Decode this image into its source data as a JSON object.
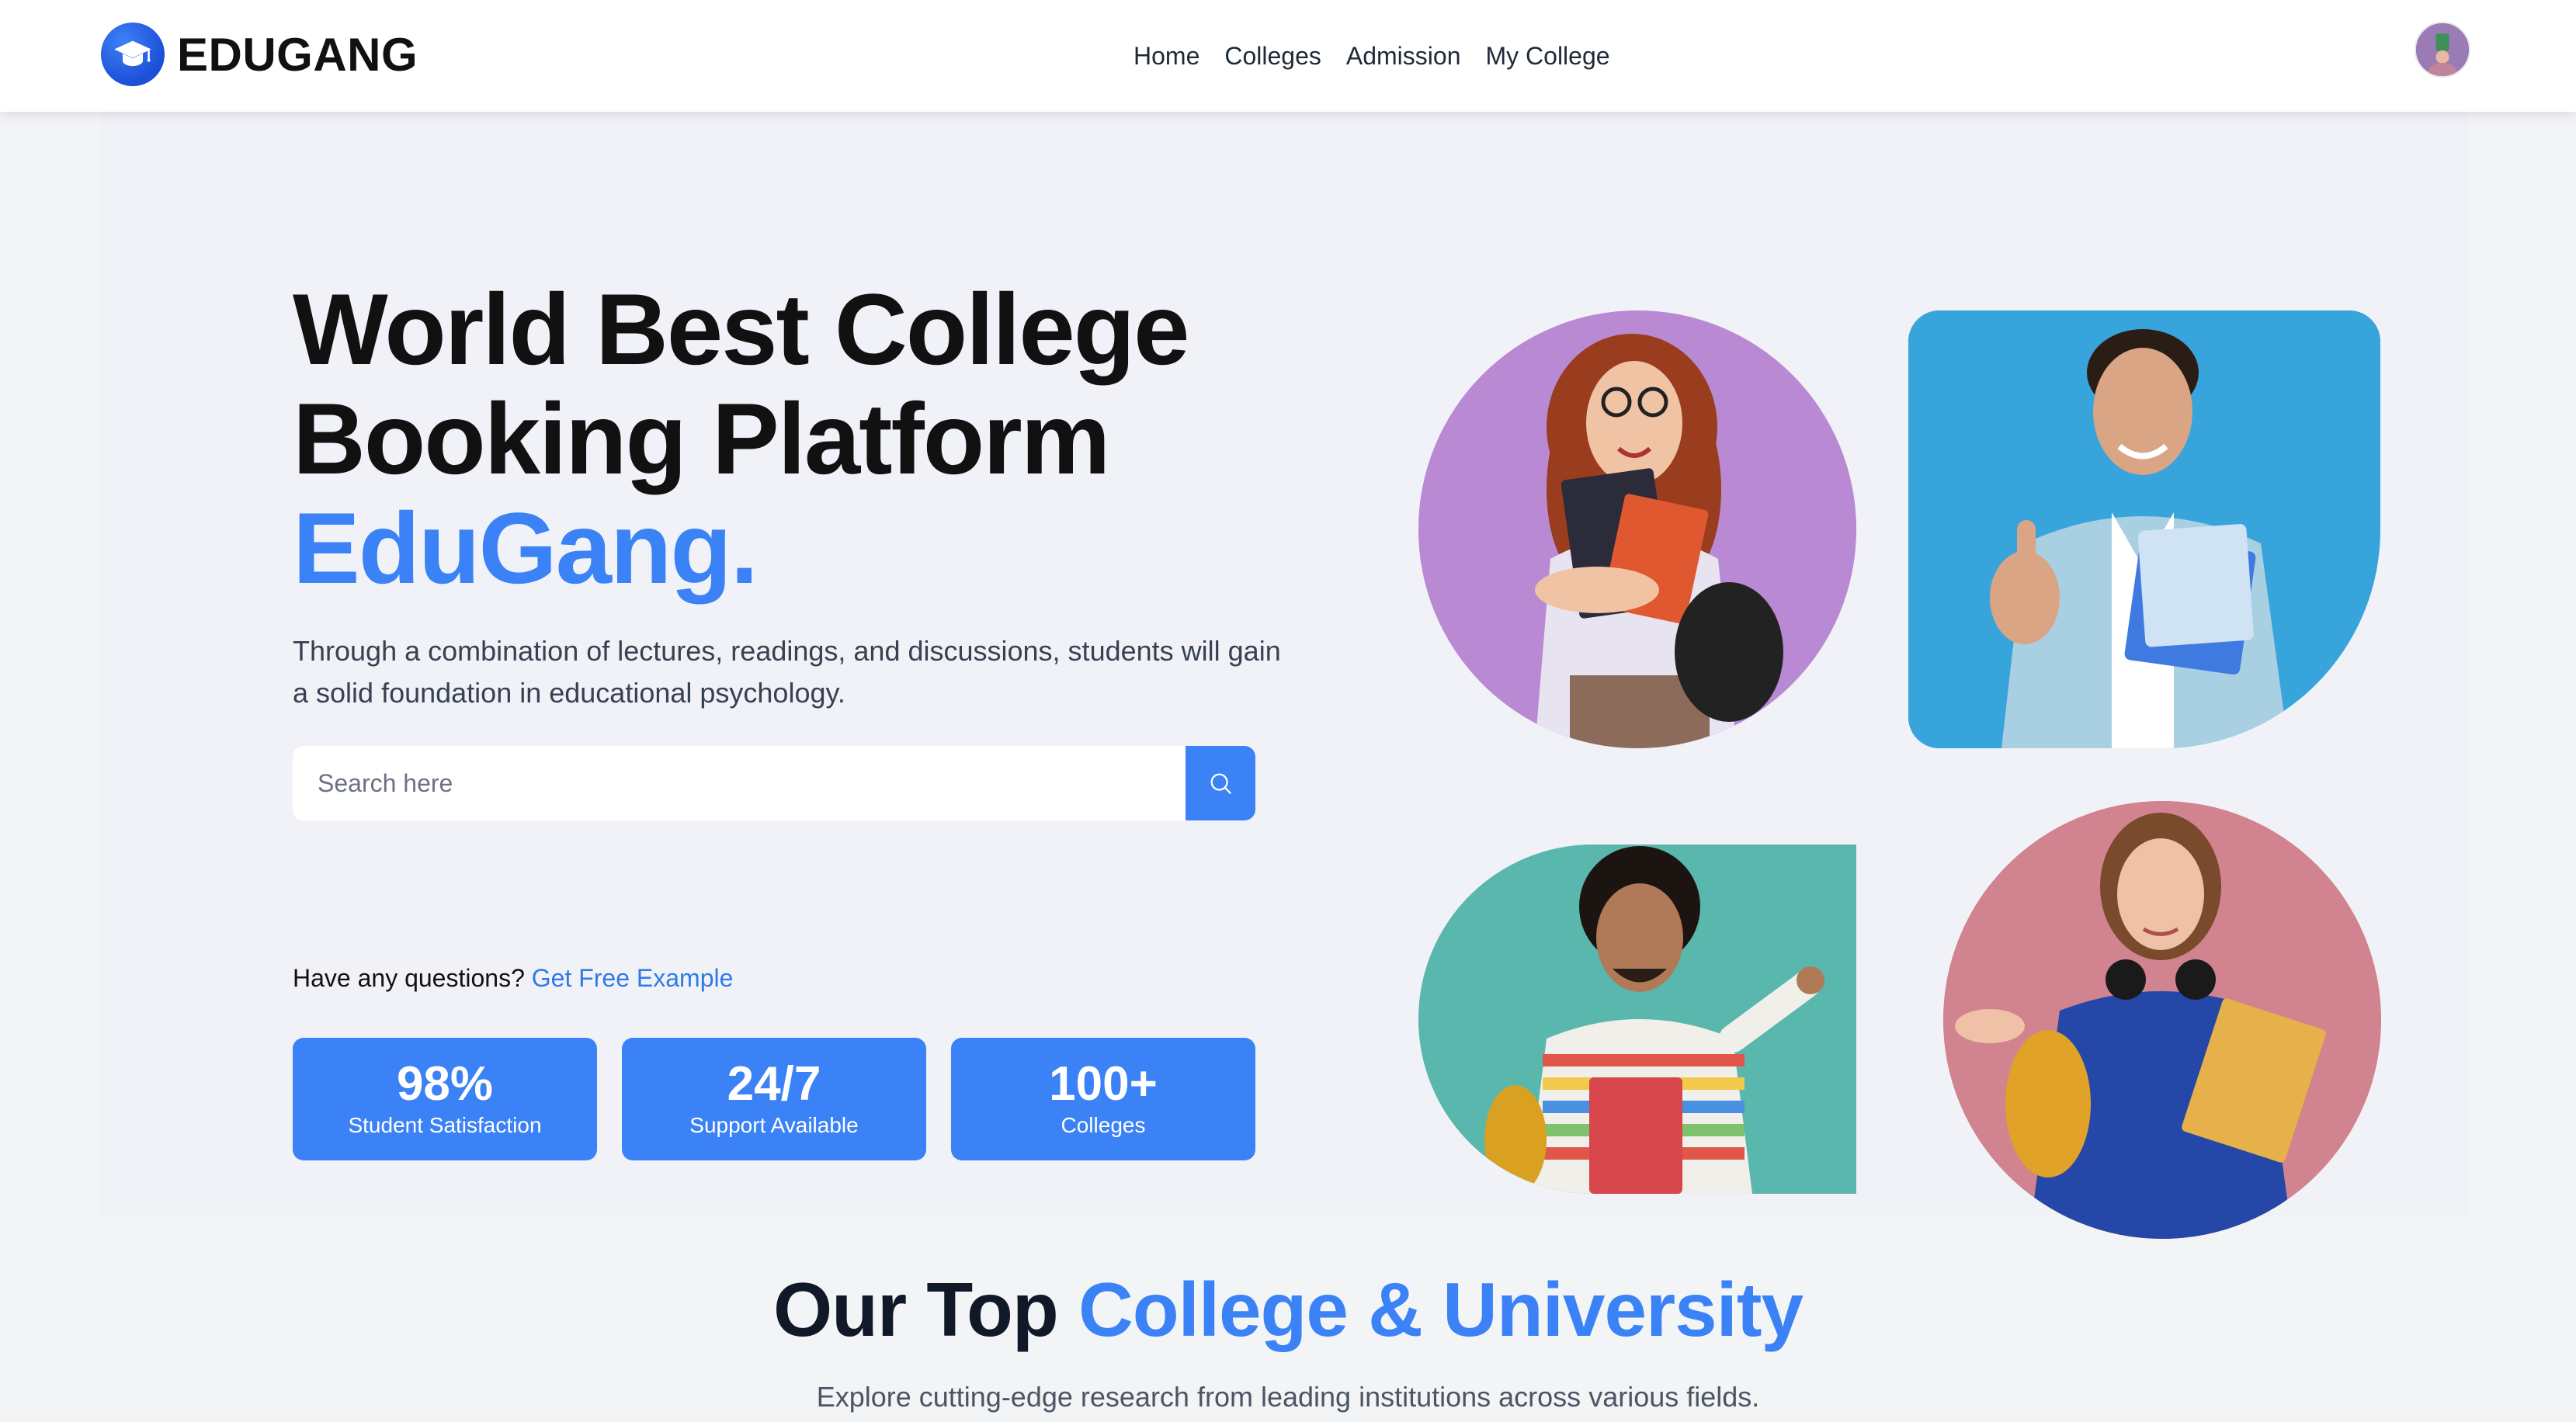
{
  "brand": {
    "name": "EDUGANG",
    "icon": "graduation-cap-icon",
    "color": "#3b82f6"
  },
  "nav": {
    "links": [
      {
        "label": "Home"
      },
      {
        "label": "Colleges"
      },
      {
        "label": "Admission"
      },
      {
        "label": "My College"
      }
    ],
    "avatar_icon": "user-avatar"
  },
  "hero": {
    "title_line1": "World Best College",
    "title_line2": "Booking Platform",
    "title_accent": "EduGang.",
    "description": "Through a combination of lectures, readings, and discussions, students will gain a solid foundation in educational psychology.",
    "search": {
      "placeholder": "Search here",
      "button_icon": "search-icon"
    },
    "questions": {
      "text": "Have any questions?",
      "link": "Get Free Example"
    },
    "stats": [
      {
        "value": "98%",
        "label": "Student Satisfaction"
      },
      {
        "value": "24/7",
        "label": "Support Available"
      },
      {
        "value": "100+",
        "label": "Colleges"
      }
    ],
    "photos": [
      {
        "name": "student-photo-1",
        "background": "#b98ad3"
      },
      {
        "name": "student-photo-2",
        "background": "#38a4dc"
      },
      {
        "name": "student-photo-3",
        "background": "#5ab7ae"
      },
      {
        "name": "student-photo-4",
        "background": "#d1838f"
      }
    ]
  },
  "section": {
    "title_prefix": "Our Top",
    "title_accent": "College & University",
    "subtitle": "Explore cutting-edge research from leading institutions across various fields."
  },
  "colors": {
    "accent": "#3b82f6",
    "link": "#2f7ae5",
    "hero_bg": "#f1f2f8",
    "page_bg": "#f3f4f6"
  }
}
